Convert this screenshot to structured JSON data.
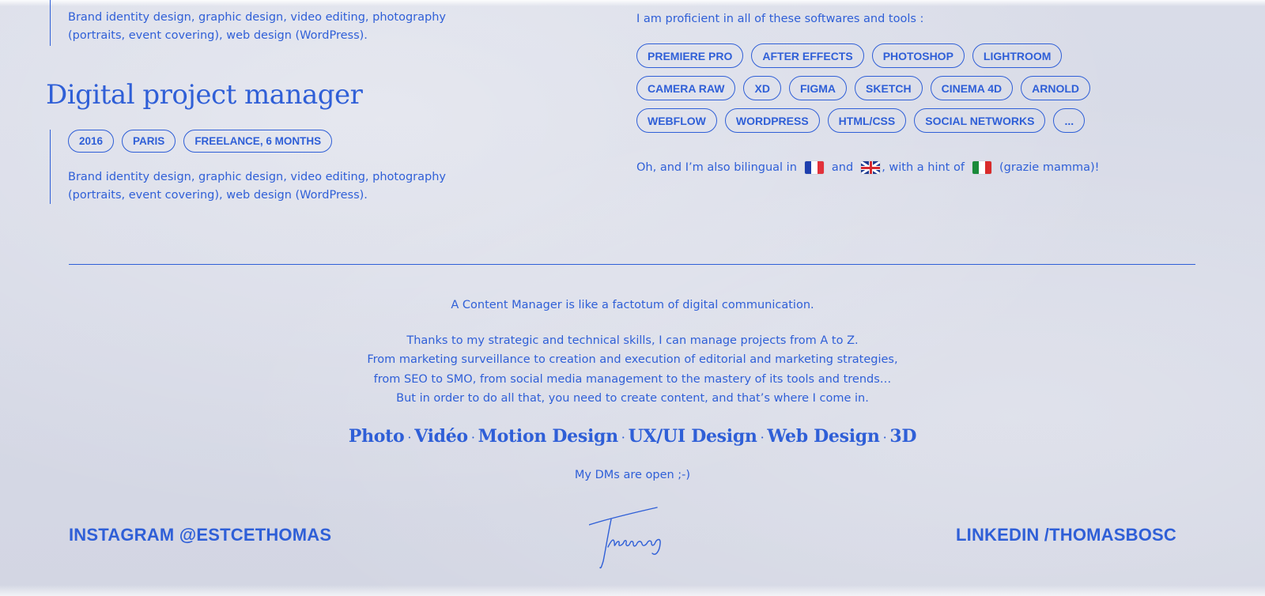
{
  "experience_top": {
    "description_line1": "Brand identity design, graphic design, video editing, photography",
    "description_line2": "(portraits, event covering), web design (WordPress)."
  },
  "experience_second": {
    "title": "Digital project manager",
    "tags": [
      "2016",
      "PARIS",
      "FREELANCE, 6 MONTHS"
    ],
    "description_line1": "Brand identity design, graphic design, video editing, photography",
    "description_line2": "(portraits, event covering), web design (WordPress)."
  },
  "skills": {
    "intro": "I am proficient in all of these softwares and tools :",
    "tools": [
      "PREMIERE PRO",
      "AFTER EFFECTS",
      "PHOTOSHOP",
      "LIGHTROOM",
      "CAMERA RAW",
      "XD",
      "FIGMA",
      "SKETCH",
      "CINEMA 4D",
      "ARNOLD",
      "WEBFLOW",
      "WORDPRESS",
      "HTML/CSS",
      "SOCIAL NETWORKS",
      "..."
    ]
  },
  "languages": {
    "prefix": "Oh, and I’m also bilingual in",
    "and": "and",
    "hint": ", with a hint of",
    "suffix": "(grazie mamma)!",
    "flags": [
      "french-flag-icon",
      "uk-flag-icon",
      "italian-flag-icon"
    ]
  },
  "about": {
    "intro": "A Content Manager is like a factotum of digital communication.",
    "body_line1": "Thanks to my strategic and technical skills, I can manage projects from A to Z.",
    "body_line2": "From marketing surveillance to creation and execution of editorial and marketing strategies,",
    "body_line3": "from SEO to SMO, from social media management to the mastery of its tools and trends…",
    "body_line4": "But in order to do all that, you need to create content, and that’s where I come in.",
    "services": [
      "Photo",
      "Vidéo",
      "Motion Design",
      "UX/UI Design",
      "Web Design",
      "3D"
    ],
    "services_separator": "·",
    "dms": "My DMs are open ;-)"
  },
  "footer": {
    "instagram": "INSTAGRAM @ESTCETHOMAS",
    "linkedin": "LINKEDIN /THOMASBOSC",
    "signature": "Thomas"
  },
  "colors": {
    "accent": "#2f5fd7",
    "paper": "#d8dbe7"
  }
}
